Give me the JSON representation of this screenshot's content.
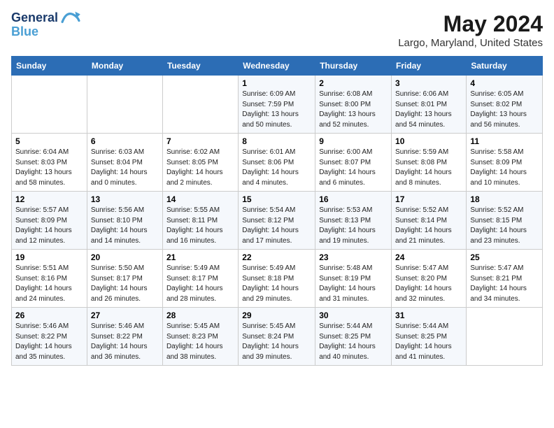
{
  "logo": {
    "line1": "General",
    "line2": "Blue"
  },
  "title": "May 2024",
  "location": "Largo, Maryland, United States",
  "headers": [
    "Sunday",
    "Monday",
    "Tuesday",
    "Wednesday",
    "Thursday",
    "Friday",
    "Saturday"
  ],
  "weeks": [
    [
      {
        "day": "",
        "sunrise": "",
        "sunset": "",
        "daylight": ""
      },
      {
        "day": "",
        "sunrise": "",
        "sunset": "",
        "daylight": ""
      },
      {
        "day": "",
        "sunrise": "",
        "sunset": "",
        "daylight": ""
      },
      {
        "day": "1",
        "sunrise": "Sunrise: 6:09 AM",
        "sunset": "Sunset: 7:59 PM",
        "daylight": "Daylight: 13 hours and 50 minutes."
      },
      {
        "day": "2",
        "sunrise": "Sunrise: 6:08 AM",
        "sunset": "Sunset: 8:00 PM",
        "daylight": "Daylight: 13 hours and 52 minutes."
      },
      {
        "day": "3",
        "sunrise": "Sunrise: 6:06 AM",
        "sunset": "Sunset: 8:01 PM",
        "daylight": "Daylight: 13 hours and 54 minutes."
      },
      {
        "day": "4",
        "sunrise": "Sunrise: 6:05 AM",
        "sunset": "Sunset: 8:02 PM",
        "daylight": "Daylight: 13 hours and 56 minutes."
      }
    ],
    [
      {
        "day": "5",
        "sunrise": "Sunrise: 6:04 AM",
        "sunset": "Sunset: 8:03 PM",
        "daylight": "Daylight: 13 hours and 58 minutes."
      },
      {
        "day": "6",
        "sunrise": "Sunrise: 6:03 AM",
        "sunset": "Sunset: 8:04 PM",
        "daylight": "Daylight: 14 hours and 0 minutes."
      },
      {
        "day": "7",
        "sunrise": "Sunrise: 6:02 AM",
        "sunset": "Sunset: 8:05 PM",
        "daylight": "Daylight: 14 hours and 2 minutes."
      },
      {
        "day": "8",
        "sunrise": "Sunrise: 6:01 AM",
        "sunset": "Sunset: 8:06 PM",
        "daylight": "Daylight: 14 hours and 4 minutes."
      },
      {
        "day": "9",
        "sunrise": "Sunrise: 6:00 AM",
        "sunset": "Sunset: 8:07 PM",
        "daylight": "Daylight: 14 hours and 6 minutes."
      },
      {
        "day": "10",
        "sunrise": "Sunrise: 5:59 AM",
        "sunset": "Sunset: 8:08 PM",
        "daylight": "Daylight: 14 hours and 8 minutes."
      },
      {
        "day": "11",
        "sunrise": "Sunrise: 5:58 AM",
        "sunset": "Sunset: 8:09 PM",
        "daylight": "Daylight: 14 hours and 10 minutes."
      }
    ],
    [
      {
        "day": "12",
        "sunrise": "Sunrise: 5:57 AM",
        "sunset": "Sunset: 8:09 PM",
        "daylight": "Daylight: 14 hours and 12 minutes."
      },
      {
        "day": "13",
        "sunrise": "Sunrise: 5:56 AM",
        "sunset": "Sunset: 8:10 PM",
        "daylight": "Daylight: 14 hours and 14 minutes."
      },
      {
        "day": "14",
        "sunrise": "Sunrise: 5:55 AM",
        "sunset": "Sunset: 8:11 PM",
        "daylight": "Daylight: 14 hours and 16 minutes."
      },
      {
        "day": "15",
        "sunrise": "Sunrise: 5:54 AM",
        "sunset": "Sunset: 8:12 PM",
        "daylight": "Daylight: 14 hours and 17 minutes."
      },
      {
        "day": "16",
        "sunrise": "Sunrise: 5:53 AM",
        "sunset": "Sunset: 8:13 PM",
        "daylight": "Daylight: 14 hours and 19 minutes."
      },
      {
        "day": "17",
        "sunrise": "Sunrise: 5:52 AM",
        "sunset": "Sunset: 8:14 PM",
        "daylight": "Daylight: 14 hours and 21 minutes."
      },
      {
        "day": "18",
        "sunrise": "Sunrise: 5:52 AM",
        "sunset": "Sunset: 8:15 PM",
        "daylight": "Daylight: 14 hours and 23 minutes."
      }
    ],
    [
      {
        "day": "19",
        "sunrise": "Sunrise: 5:51 AM",
        "sunset": "Sunset: 8:16 PM",
        "daylight": "Daylight: 14 hours and 24 minutes."
      },
      {
        "day": "20",
        "sunrise": "Sunrise: 5:50 AM",
        "sunset": "Sunset: 8:17 PM",
        "daylight": "Daylight: 14 hours and 26 minutes."
      },
      {
        "day": "21",
        "sunrise": "Sunrise: 5:49 AM",
        "sunset": "Sunset: 8:17 PM",
        "daylight": "Daylight: 14 hours and 28 minutes."
      },
      {
        "day": "22",
        "sunrise": "Sunrise: 5:49 AM",
        "sunset": "Sunset: 8:18 PM",
        "daylight": "Daylight: 14 hours and 29 minutes."
      },
      {
        "day": "23",
        "sunrise": "Sunrise: 5:48 AM",
        "sunset": "Sunset: 8:19 PM",
        "daylight": "Daylight: 14 hours and 31 minutes."
      },
      {
        "day": "24",
        "sunrise": "Sunrise: 5:47 AM",
        "sunset": "Sunset: 8:20 PM",
        "daylight": "Daylight: 14 hours and 32 minutes."
      },
      {
        "day": "25",
        "sunrise": "Sunrise: 5:47 AM",
        "sunset": "Sunset: 8:21 PM",
        "daylight": "Daylight: 14 hours and 34 minutes."
      }
    ],
    [
      {
        "day": "26",
        "sunrise": "Sunrise: 5:46 AM",
        "sunset": "Sunset: 8:22 PM",
        "daylight": "Daylight: 14 hours and 35 minutes."
      },
      {
        "day": "27",
        "sunrise": "Sunrise: 5:46 AM",
        "sunset": "Sunset: 8:22 PM",
        "daylight": "Daylight: 14 hours and 36 minutes."
      },
      {
        "day": "28",
        "sunrise": "Sunrise: 5:45 AM",
        "sunset": "Sunset: 8:23 PM",
        "daylight": "Daylight: 14 hours and 38 minutes."
      },
      {
        "day": "29",
        "sunrise": "Sunrise: 5:45 AM",
        "sunset": "Sunset: 8:24 PM",
        "daylight": "Daylight: 14 hours and 39 minutes."
      },
      {
        "day": "30",
        "sunrise": "Sunrise: 5:44 AM",
        "sunset": "Sunset: 8:25 PM",
        "daylight": "Daylight: 14 hours and 40 minutes."
      },
      {
        "day": "31",
        "sunrise": "Sunrise: 5:44 AM",
        "sunset": "Sunset: 8:25 PM",
        "daylight": "Daylight: 14 hours and 41 minutes."
      },
      {
        "day": "",
        "sunrise": "",
        "sunset": "",
        "daylight": ""
      }
    ]
  ]
}
